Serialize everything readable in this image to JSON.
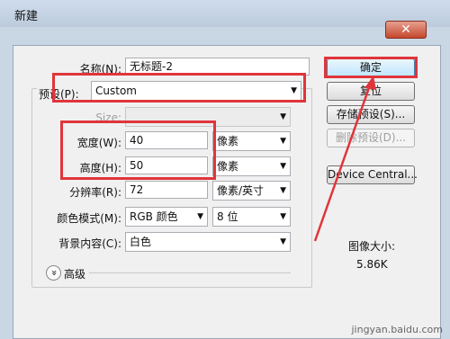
{
  "window": {
    "title": "新建",
    "close_glyph": "✕"
  },
  "form": {
    "name_label": "名称(N):",
    "name_value": "无标题-2",
    "preset_label": "预设(P):",
    "preset_value": "Custom",
    "size_label": "Size:",
    "size_value": "",
    "width_label": "宽度(W):",
    "width_value": "40",
    "width_unit": "像素",
    "height_label": "高度(H):",
    "height_value": "50",
    "height_unit": "像素",
    "resolution_label": "分辨率(R):",
    "resolution_value": "72",
    "resolution_unit": "像素/英寸",
    "color_mode_label": "颜色模式(M):",
    "color_mode_value": "RGB 颜色",
    "bit_depth_value": "8 位",
    "background_label": "背景内容(C):",
    "background_value": "白色",
    "advanced_label": "高级",
    "advanced_glyph": "»"
  },
  "buttons": {
    "ok": "确定",
    "reset": "复位",
    "save_preset": "存储预设(S)...",
    "delete_preset": "删除预设(D)...",
    "device_central": "Device Central..."
  },
  "info": {
    "image_size_label": "图像大小:",
    "image_size_value": "5.86K"
  },
  "watermark": "jingyan.baidu.com",
  "icons": {
    "dropdown": "chevron-down-icon",
    "advanced": "double-chevron-icon"
  },
  "colors": {
    "highlight_red": "#e0353b",
    "default_button_border": "#3c7fb1"
  }
}
